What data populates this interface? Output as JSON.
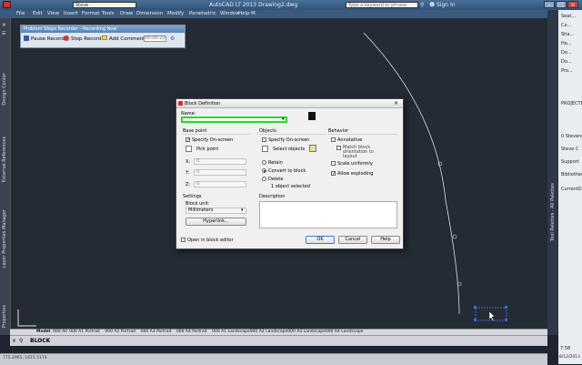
{
  "app": {
    "title": "AutoCAD LT 2013    Drawing2.dwg",
    "workspace": "Steve",
    "search_placeholder": "Type a keyword or phrase",
    "signin": "Sign In",
    "menus": [
      "File",
      "Edit",
      "View",
      "Insert",
      "Format",
      "Tools",
      "Draw",
      "Dimension",
      "Modify",
      "Parametric",
      "Window",
      "Help",
      "M"
    ]
  },
  "side_panels": {
    "left": [
      "Design Center",
      "External References",
      "Layer Properties Manager",
      "Properties"
    ],
    "right": [
      "Tool Palettes - All Palettes"
    ]
  },
  "steps_recorder": {
    "title": "Problem Steps Recorder - Recording Now",
    "pause": "Pause Record",
    "stop": "Stop Record",
    "add_comment": "Add Comment",
    "timer": "00:00:23"
  },
  "dialog": {
    "title": "Block Definition",
    "name_label": "Name:",
    "name_value": "",
    "base_point": {
      "group": "Base point",
      "specify_onscreen": "Specify On-screen",
      "pick_point": "Pick point",
      "x_label": "X:",
      "x_value": "0",
      "y_label": "Y:",
      "y_value": "0",
      "z_label": "Z:",
      "z_value": "0"
    },
    "objects": {
      "group": "Objects",
      "specify_onscreen": "Specify On-screen",
      "select_objects": "Select objects",
      "retain": "Retain",
      "convert": "Convert to block",
      "delete": "Delete",
      "count": "1 object selected"
    },
    "behavior": {
      "group": "Behavior",
      "annotative": "Annotative",
      "match": "Match block orientation to layout",
      "scale_uniform": "Scale uniformly",
      "allow_explode": "Allow exploding"
    },
    "settings": {
      "group": "Settings",
      "unit_label": "Block unit:",
      "unit_value": "Millimeters",
      "hyperlink": "Hyperlink..."
    },
    "description_label": "Description",
    "open_in_editor": "Open in block editor",
    "ok": "OK",
    "cancel": "Cancel",
    "help": "Help"
  },
  "layout_tabs": [
    "Model",
    "000 A0",
    "000 A1 Portrait",
    "000 A2 Portrait",
    "000 A3 Portrait",
    "000 A4 Portrait",
    "000 A1 Landscape",
    "000 A2 Landscape",
    "000 A3 Landscape",
    "000 A4 Landscape"
  ],
  "command_line": "BLOCK",
  "status": {
    "coords": "775.2965, 1615.5174",
    "time": "7:58",
    "date": "18/12/2013"
  },
  "right_panel_items": [
    "Seat...",
    "Co...",
    "Sha...",
    "Ha...",
    "Do...",
    "Do...",
    "Pro...",
    "PROJECTEN",
    "0 Stevens",
    "Steve C",
    "Support",
    "Bibliotheek",
    "CurrentDraw"
  ],
  "colors": {
    "name_field_highlight": "#22dd22",
    "selection_grip": "#2f6fe0"
  }
}
